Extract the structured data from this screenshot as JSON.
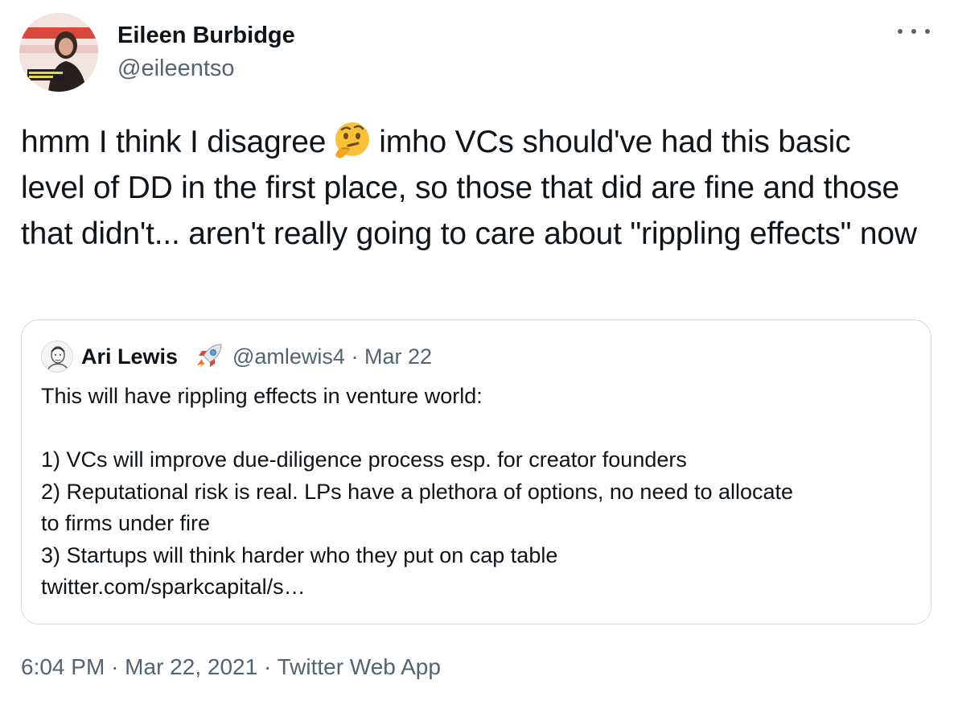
{
  "author": {
    "name": "Eileen Burbidge",
    "handle": "@eileentso"
  },
  "tweet": {
    "text_before_emoji": "hmm I think I disagree",
    "emoji": "thinking-face",
    "text_after_emoji": "imho VCs should've had this basic level of DD in the first place, so those that did are fine and those that didn't... aren't really going to care about \"rippling effects\" now"
  },
  "quoted_tweet": {
    "name": "Ari Lewis",
    "name_emoji": "rocket",
    "handle": "@amlewis4",
    "separator": "·",
    "date": "Mar 22",
    "lines": [
      "This will have rippling effects in venture world:",
      "",
      "1) VCs will improve due-diligence process esp. for creator founders",
      "2) Reputational risk is real. LPs have a plethora of options, no need to allocate",
      "to firms under fire",
      "3) Startups will think harder who they put on cap table",
      "twitter.com/sparkcapital/s…"
    ]
  },
  "footer": {
    "time": "6:04 PM",
    "date": "Mar 22, 2021",
    "separator": "·",
    "source": "Twitter Web App"
  },
  "colors": {
    "text": "#0f1419",
    "secondary": "#536471",
    "border": "#cfd9de"
  }
}
